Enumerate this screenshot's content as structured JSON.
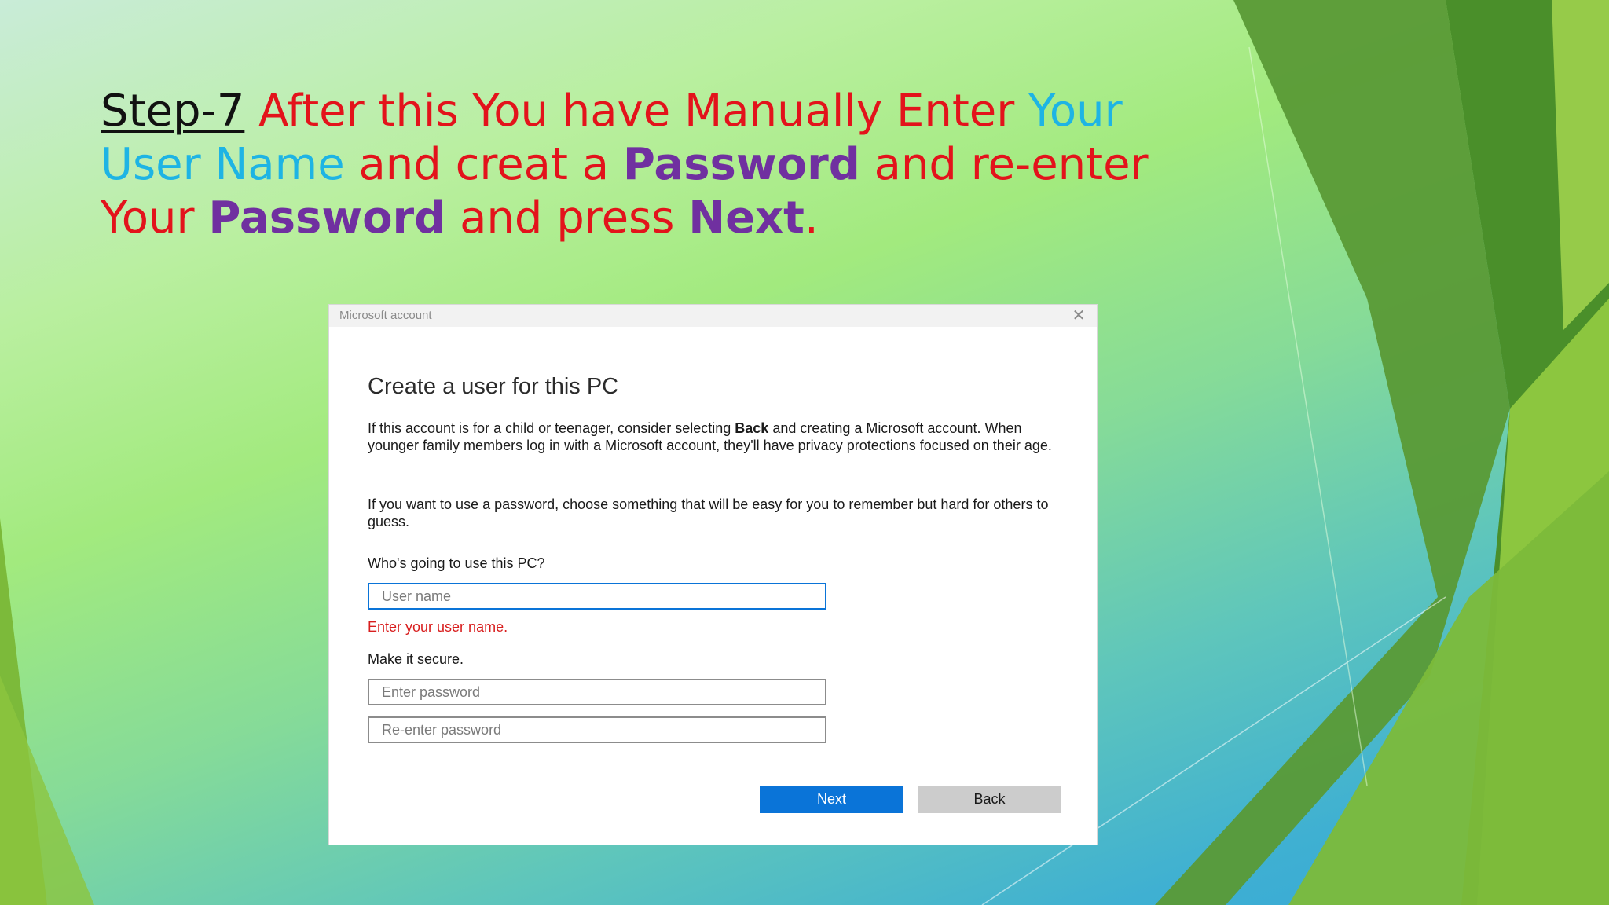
{
  "slide": {
    "title_parts": [
      "Step-7",
      "After this You have Manually Enter",
      "Your User Name",
      "and creat a",
      "Password",
      "and re-enter Your",
      "Password",
      "and press",
      "Next",
      "."
    ],
    "colors": {
      "step": "#111111",
      "red": "#e3131b",
      "cyan": "#1eb4e4",
      "purple": "#7030a0",
      "green_dark": "#4a8f2a",
      "green_light": "#8cc63f"
    }
  },
  "dialog": {
    "window_title": "Microsoft account",
    "close_icon": "close-icon",
    "heading": "Create a user for this PC",
    "para1_before": "If this account is for a child or teenager, consider selecting",
    "para1_bold": "Back",
    "para1_after": "and creating a Microsoft account. When younger family members log in with a Microsoft account, they'll have privacy protections focused on their age.",
    "para2": "If you want to use a password, choose something that will be easy for you to remember but hard for others to guess.",
    "who_label": "Who's going to use this PC?",
    "username_placeholder": "User name",
    "error_text": "Enter your user name.",
    "secure_label": "Make it secure.",
    "password_placeholder": "Enter password",
    "reenter_placeholder": "Re-enter password",
    "next_label": "Next",
    "back_label": "Back",
    "colors": {
      "accent": "#0a74d8",
      "error": "#d81e1e",
      "secondary_button": "#cccccc"
    }
  }
}
